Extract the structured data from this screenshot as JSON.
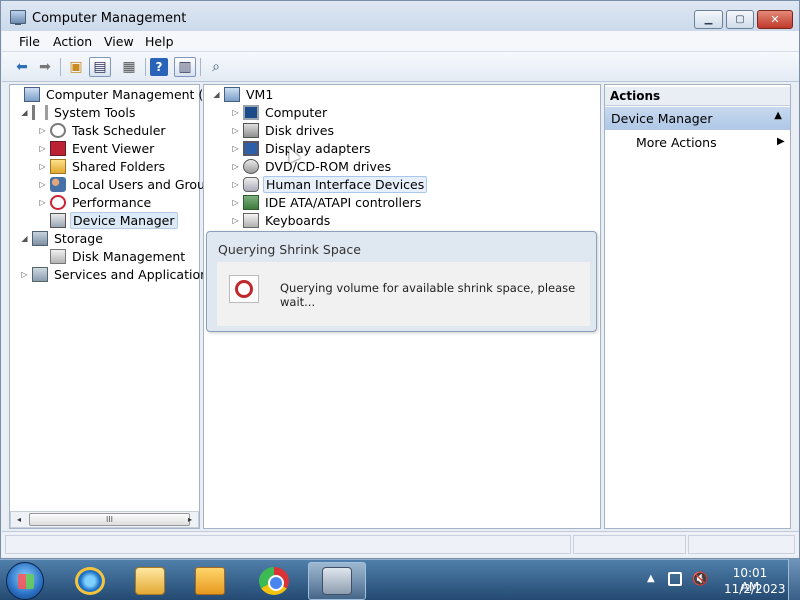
{
  "window": {
    "title": "Computer Management",
    "minimize_label": "▁",
    "maximize_label": "▢",
    "close_label": "✕"
  },
  "menu": [
    "File",
    "Action",
    "View",
    "Help"
  ],
  "left_tree": [
    {
      "label": "Computer Management (Local",
      "icon": "computer-management-icon",
      "level": 0,
      "arrow": ""
    },
    {
      "label": "System Tools",
      "icon": "system-tools-icon",
      "level": 1,
      "arrow": "◢"
    },
    {
      "label": "Task Scheduler",
      "icon": "task-scheduler-icon",
      "level": 2,
      "arrow": "▷"
    },
    {
      "label": "Event Viewer",
      "icon": "event-viewer-icon",
      "level": 2,
      "arrow": "▷"
    },
    {
      "label": "Shared Folders",
      "icon": "shared-folders-icon",
      "level": 2,
      "arrow": "▷"
    },
    {
      "label": "Local Users and Groups",
      "icon": "local-users-icon",
      "level": 2,
      "arrow": "▷"
    },
    {
      "label": "Performance",
      "icon": "performance-icon",
      "level": 2,
      "arrow": "▷"
    },
    {
      "label": "Device Manager",
      "icon": "device-manager-icon",
      "level": 2,
      "arrow": "",
      "selected": true
    },
    {
      "label": "Storage",
      "icon": "storage-icon",
      "level": 1,
      "arrow": "◢"
    },
    {
      "label": "Disk Management",
      "icon": "disk-management-icon",
      "level": 2,
      "arrow": ""
    },
    {
      "label": "Services and Applications",
      "icon": "services-applications-icon",
      "level": 1,
      "arrow": "▷"
    }
  ],
  "device_tree": {
    "root": "VM1",
    "items": [
      {
        "label": "Computer",
        "icon": "computer-icon"
      },
      {
        "label": "Disk drives",
        "icon": "disk-drive-icon"
      },
      {
        "label": "Display adapters",
        "icon": "display-adapter-icon"
      },
      {
        "label": "DVD/CD-ROM drives",
        "icon": "dvd-drive-icon"
      },
      {
        "label": "Human Interface Devices",
        "icon": "hid-icon",
        "hover": true
      },
      {
        "label": "IDE ATA/ATAPI controllers",
        "icon": "ide-controller-icon"
      },
      {
        "label": "Keyboards",
        "icon": "keyboard-icon"
      }
    ]
  },
  "actions": {
    "header": "Actions",
    "section": "Device Manager",
    "more": "More Actions"
  },
  "dialog": {
    "title": "Querying Shrink Space",
    "message": "Querying volume for available shrink space, please wait..."
  },
  "scrollbar": {
    "left": "◂",
    "right": "▸",
    "grip": "III"
  },
  "taskbar": {
    "time": "10:01 AM",
    "date": "11/2/2023",
    "tray_arrow": "▲",
    "volume_glyph": "🔇"
  },
  "colors": {
    "window_bg": "#e9eef5",
    "selection": "#dce9f7",
    "actions_section": "#bcd2ec",
    "taskbar": "#3a6591"
  }
}
